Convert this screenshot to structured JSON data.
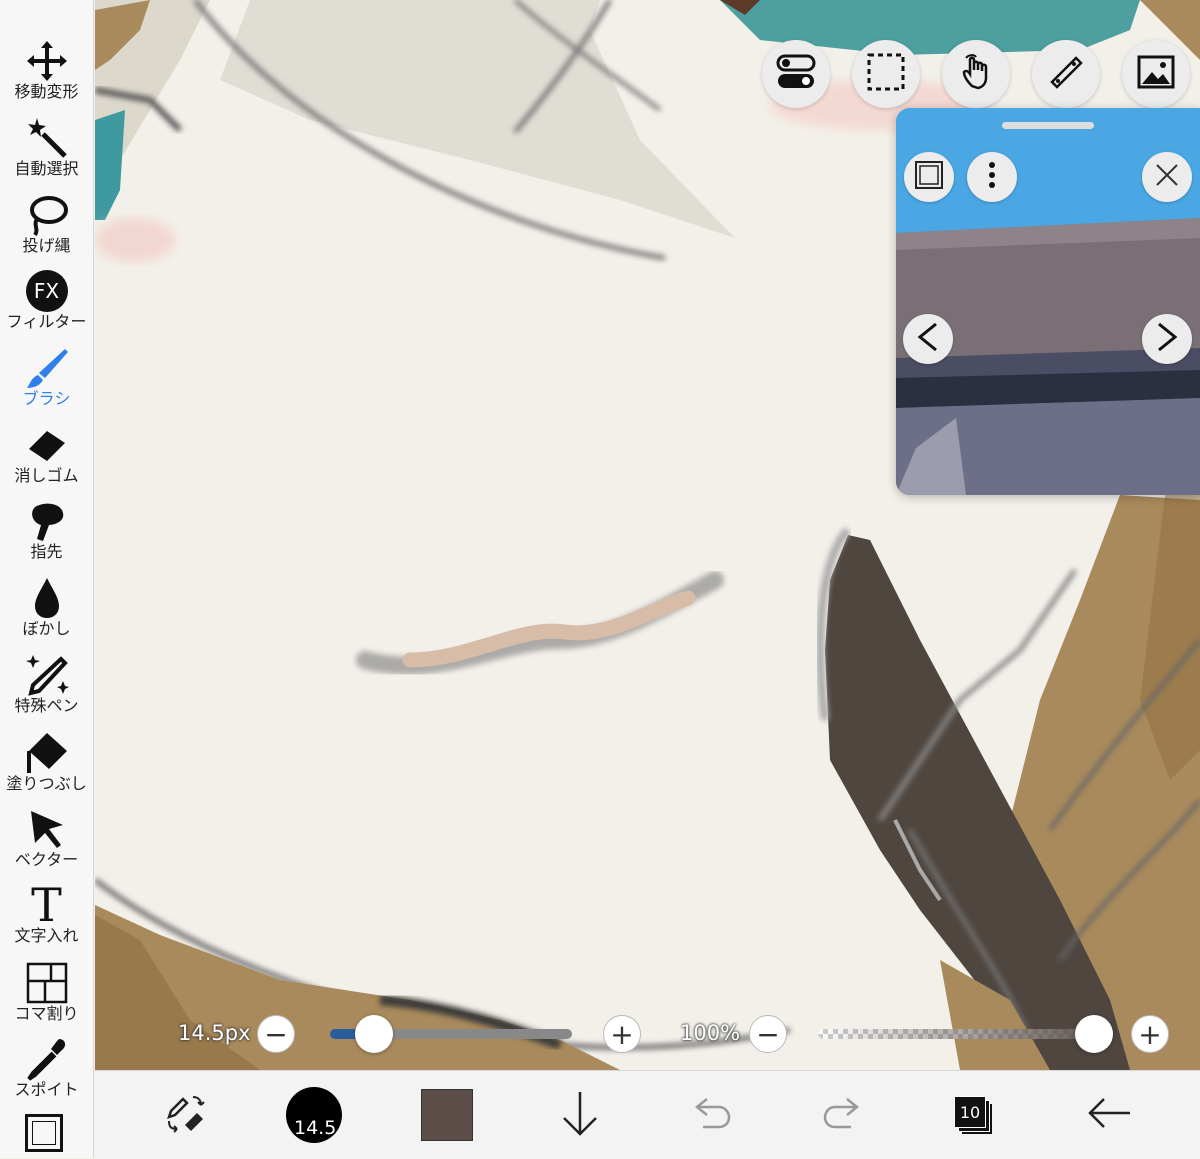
{
  "sidebar": {
    "tools": [
      {
        "label": "移動変形",
        "icon": "move-icon"
      },
      {
        "label": "自動選択",
        "icon": "magic-wand-icon"
      },
      {
        "label": "投げ縄",
        "icon": "lasso-icon"
      },
      {
        "label": "フィルター",
        "icon": "fx-icon",
        "icon_text": "FX"
      },
      {
        "label": "ブラシ",
        "icon": "brush-icon",
        "active": true
      },
      {
        "label": "消しゴム",
        "icon": "eraser-icon"
      },
      {
        "label": "指先",
        "icon": "finger-icon"
      },
      {
        "label": "ぼかし",
        "icon": "blur-drop-icon"
      },
      {
        "label": "特殊ペン",
        "icon": "special-pen-icon"
      },
      {
        "label": "塗りつぶし",
        "icon": "fill-bucket-icon"
      },
      {
        "label": "ベクター",
        "icon": "vector-arrow-icon"
      },
      {
        "label": "文字入れ",
        "icon": "text-icon",
        "icon_text": "T"
      },
      {
        "label": "コマ割り",
        "icon": "frame-divide-icon"
      },
      {
        "label": "スポイト",
        "icon": "eyedropper-icon"
      }
    ]
  },
  "top_toolbar": {
    "buttons": [
      "toggle-icon",
      "selection-rect-icon",
      "hand-touch-icon",
      "ruler-icon",
      "image-icon"
    ]
  },
  "reference_panel": {
    "buttons": [
      "frame-icon",
      "more-vertical-icon",
      "close-icon",
      "chevron-left-icon",
      "chevron-right-icon"
    ]
  },
  "brush_size": {
    "label": "14.5px",
    "value_fraction": 0.18
  },
  "opacity": {
    "label": "100%",
    "value_fraction": 1.0
  },
  "bottom_bar": {
    "brush_size_text": "14.5",
    "color": "#5b4d48",
    "layer_count": "10"
  },
  "colors": {
    "accent": "#2f80ed",
    "slider_fill": "#2a5c9e",
    "canvas_bg": "#f3f0ea"
  }
}
